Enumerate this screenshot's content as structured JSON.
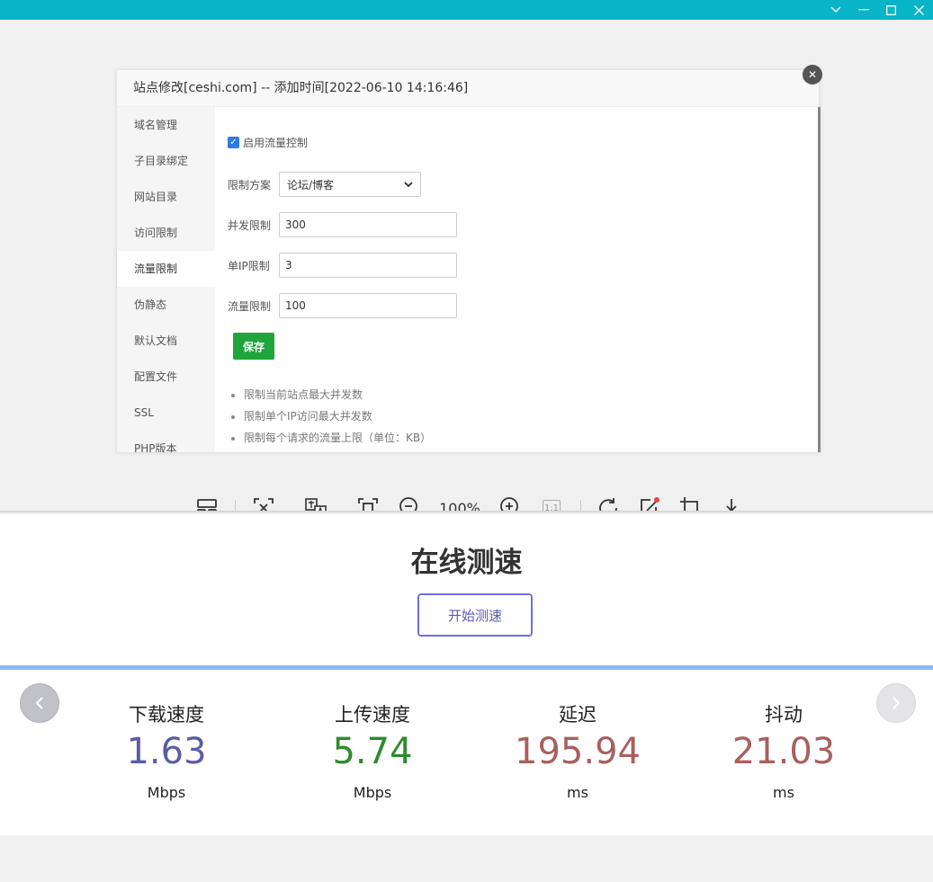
{
  "dialog": {
    "title": "站点修改[ceshi.com] -- 添加时间[2022-06-10 14:16:46]",
    "menu": [
      "域名管理",
      "子目录绑定",
      "网站目录",
      "访问限制",
      "流量限制",
      "伪静态",
      "默认文档",
      "配置文件",
      "SSL",
      "PHP版本"
    ],
    "active_menu": "流量限制",
    "enable_label": "启用流量控制",
    "enabled": true,
    "scheme_label": "限制方案",
    "scheme_value": "论坛/博客",
    "concurrency_label": "并发限制",
    "concurrency_value": "300",
    "per_ip_label": "单IP限制",
    "per_ip_value": "3",
    "traffic_label": "流量限制",
    "traffic_value": "100",
    "save_label": "保存",
    "tips": [
      "限制当前站点最大并发数",
      "限制单个IP访问最大并发数",
      "限制每个请求的流量上限（单位：KB）"
    ]
  },
  "toolbar": {
    "zoom": "100%",
    "actual_size": "1:1"
  },
  "speedtest": {
    "title": "在线测速",
    "start_label": "开始测速",
    "metrics": [
      {
        "label": "下载速度",
        "value": "1.63",
        "unit": "Mbps",
        "color": "#5b5ba8"
      },
      {
        "label": "上传速度",
        "value": "5.74",
        "unit": "Mbps",
        "color": "#2e8b2e"
      },
      {
        "label": "延迟",
        "value": "195.94",
        "unit": "ms",
        "color": "#a8605f"
      },
      {
        "label": "抖动",
        "value": "21.03",
        "unit": "ms",
        "color": "#a8605f"
      }
    ]
  }
}
